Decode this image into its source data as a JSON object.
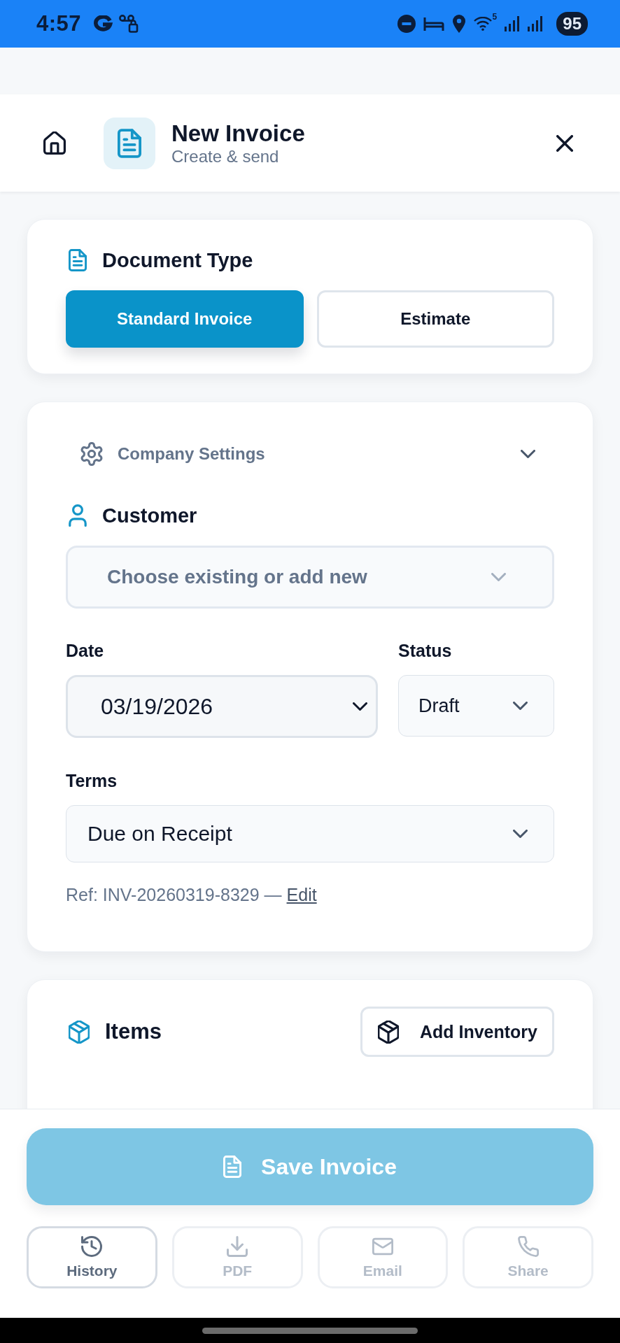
{
  "status_bar": {
    "time": "4:57",
    "wifi_band": "5",
    "battery": "95"
  },
  "header": {
    "title": "New Invoice",
    "subtitle": "Create & send"
  },
  "document_type": {
    "title": "Document Type",
    "options": [
      {
        "label": "Standard Invoice",
        "selected": true
      },
      {
        "label": "Estimate",
        "selected": false
      }
    ]
  },
  "company_settings": {
    "label": "Company Settings",
    "expanded": false
  },
  "customer": {
    "title": "Customer",
    "placeholder": "Choose existing or add new"
  },
  "date": {
    "label": "Date",
    "value": "03/19/2026"
  },
  "status": {
    "label": "Status",
    "value": "Draft"
  },
  "terms": {
    "label": "Terms",
    "value": "Due on Receipt"
  },
  "reference": {
    "text": "Ref: INV-20260319-8329 —",
    "link": "Edit"
  },
  "items": {
    "title": "Items",
    "add_button": "Add Inventory"
  },
  "save_button": {
    "label": "Save Invoice",
    "disabled": true
  },
  "actions": [
    {
      "label": "History",
      "disabled": false
    },
    {
      "label": "PDF",
      "disabled": true
    },
    {
      "label": "Email",
      "disabled": true
    },
    {
      "label": "Share",
      "disabled": true
    }
  ]
}
